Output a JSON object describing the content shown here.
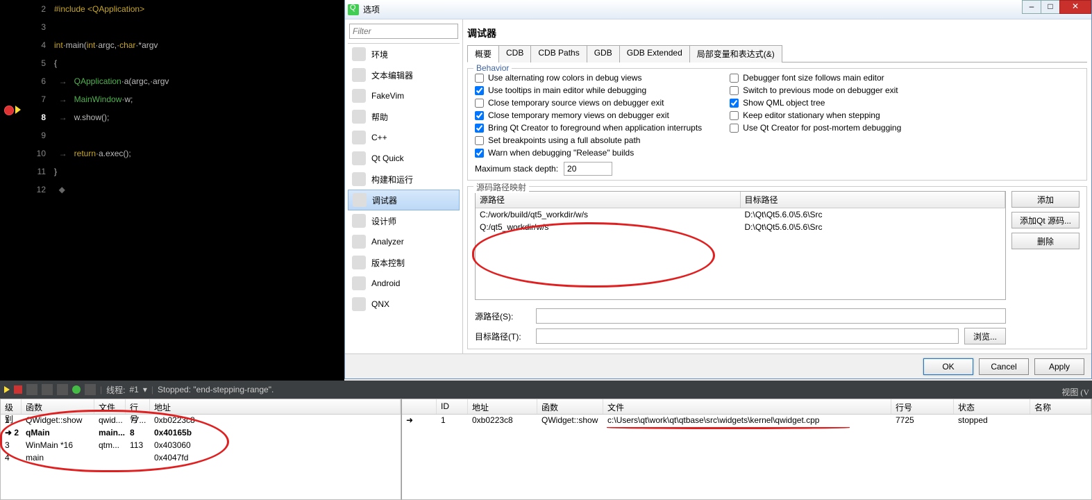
{
  "code": {
    "lines": [
      "2",
      "3",
      "4",
      "5",
      "6",
      "7",
      "8",
      "9",
      "10",
      "11",
      "12"
    ],
    "l2": "#include <QApplication>",
    "l4a": "int",
    "l4b": "·main(",
    "l4c": "int",
    "l4d": "·argc,·",
    "l4e": "char",
    "l4f": "·*argv",
    "l5": "{",
    "l6a": "QApplication",
    "l6b": "·a(argc,·argv",
    "l7a": "MainWindow",
    "l7b": "·w;",
    "l8": "w.show();",
    "l10a": "return",
    "l10b": "·a.exec();",
    "l11": "}"
  },
  "dialog": {
    "title": "选项",
    "filter": "Filter",
    "cats": [
      "环境",
      "文本编辑器",
      "FakeVim",
      "帮助",
      "C++",
      "Qt Quick",
      "构建和运行",
      "调试器",
      "设计师",
      "Analyzer",
      "版本控制",
      "Android",
      "QNX"
    ],
    "pane_title": "调试器",
    "tabs": [
      "概要",
      "CDB",
      "CDB Paths",
      "GDB",
      "GDB Extended",
      "局部变量和表达式(&)"
    ],
    "behavior_legend": "Behavior",
    "checks_left": [
      {
        "t": "Use alternating row colors in debug views",
        "c": false
      },
      {
        "t": "Use tooltips in main editor while debugging",
        "c": true
      },
      {
        "t": "Close temporary source views on debugger exit",
        "c": false
      },
      {
        "t": "Close temporary memory views on debugger exit",
        "c": true
      },
      {
        "t": "Bring Qt Creator to foreground when application interrupts",
        "c": true
      },
      {
        "t": "Set breakpoints using a full absolute path",
        "c": false
      },
      {
        "t": "Warn when debugging \"Release\" builds",
        "c": true
      }
    ],
    "checks_right": [
      {
        "t": "Debugger font size follows main editor",
        "c": false
      },
      {
        "t": "Switch to previous mode on debugger exit",
        "c": false
      },
      {
        "t": "Show QML object tree",
        "c": true
      },
      {
        "t": "Keep editor stationary when stepping",
        "c": false
      },
      {
        "t": "Use Qt Creator for post-mortem debugging",
        "c": false
      }
    ],
    "stack_label": "Maximum stack depth:",
    "stack_val": "20",
    "map_legend": "源码路径映射",
    "map_hdr_src": "源路径",
    "map_hdr_tgt": "目标路径",
    "map_rows": [
      {
        "s": "C:/work/build/qt5_workdir/w/s",
        "t": "D:\\Qt\\Qt5.6.0\\5.6\\Src"
      },
      {
        "s": "Q:/qt5_workdir/w/s",
        "t": "D:\\Qt\\Qt5.6.0\\5.6\\Src"
      }
    ],
    "btn_add": "添加",
    "btn_addqt": "添加Qt 源码...",
    "btn_del": "删除",
    "src_label": "源路径(S):",
    "tgt_label": "目标路径(T):",
    "btn_browse": "浏览...",
    "ok": "OK",
    "cancel": "Cancel",
    "apply": "Apply"
  },
  "toolbar": {
    "thread_lbl": "线程:",
    "thread_val": "#1",
    "sep": "▾",
    "status": "Stopped: \"end-stepping-range\".",
    "view": "视图 (V"
  },
  "stack": {
    "hdr": [
      "级别",
      "函数",
      "文件",
      "行号",
      "地址"
    ],
    "rows": [
      {
        "lv": "1",
        "fn": "QWidget::show",
        "fl": "qwid...",
        "ln": "77...",
        "ad": "0xb0223c8"
      },
      {
        "lv": "2",
        "fn": "qMain",
        "fl": "main...",
        "ln": "8",
        "ad": "0x40165b"
      },
      {
        "lv": "3",
        "fn": "WinMain *16",
        "fl": "qtm...",
        "ln": "113",
        "ad": "0x403060"
      },
      {
        "lv": "4",
        "fn": "main",
        "fl": "",
        "ln": "",
        "ad": "0x4047fd"
      }
    ]
  },
  "thread": {
    "hdr": [
      "",
      "ID",
      "地址",
      "函数",
      "文件",
      "行号",
      "状态",
      "名称"
    ],
    "row": {
      "id": "1",
      "addr": "0xb0223c8",
      "fn": "QWidget::show",
      "file": "c:\\Users\\qt\\work\\qt\\qtbase\\src\\widgets\\kernel\\qwidget.cpp",
      "line": "7725",
      "status": "stopped",
      "name": ""
    }
  }
}
